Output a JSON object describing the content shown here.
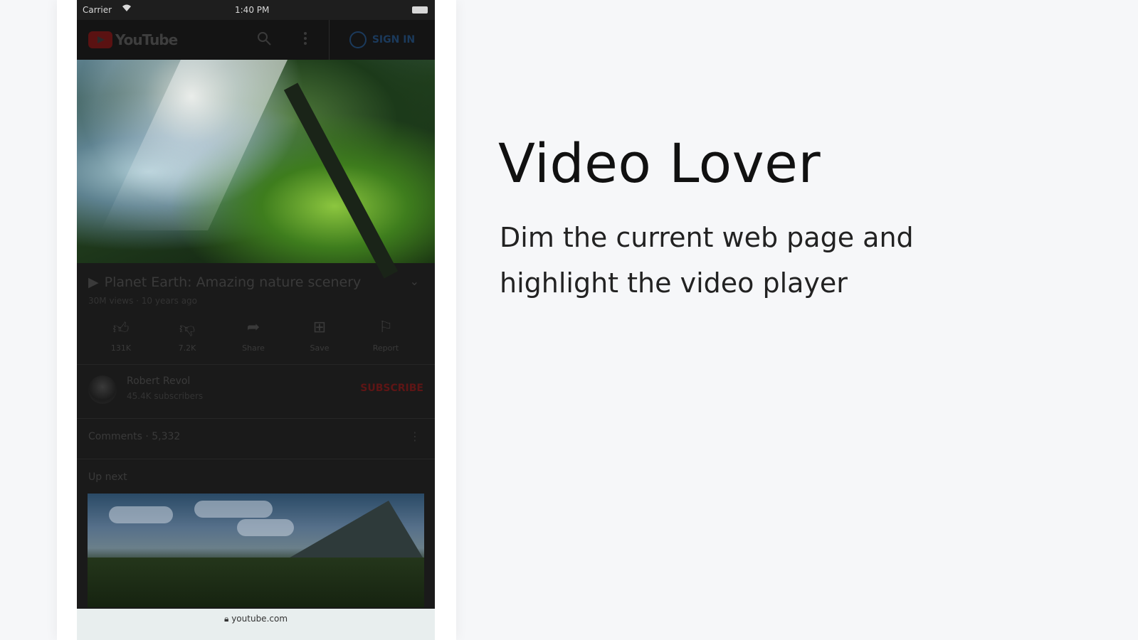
{
  "promo": {
    "title": "Video Lover",
    "description": "Dim the current web page and highlight the video player"
  },
  "status_bar": {
    "carrier": "Carrier",
    "time": "1:40 PM"
  },
  "youtube": {
    "logo_text": "YouTube",
    "sign_in_label": "SIGN IN",
    "video": {
      "title": "Planet Earth: Amazing nature scenery",
      "meta": "30M views · 10 years ago"
    },
    "actions": [
      {
        "icon": "thumbs-up-icon",
        "label": "131K"
      },
      {
        "icon": "thumbs-down-icon",
        "label": "7.2K"
      },
      {
        "icon": "share-icon",
        "label": "Share"
      },
      {
        "icon": "save-icon",
        "label": "Save"
      },
      {
        "icon": "flag-icon",
        "label": "Report"
      }
    ],
    "channel": {
      "name": "Robert Revol",
      "subscribers": "45.4K subscribers",
      "subscribe_label": "SUBSCRIBE"
    },
    "comments_label": "Comments · 5,332",
    "up_next_label": "Up next"
  },
  "browser": {
    "url": "youtube.com"
  },
  "colors": {
    "page_background": "#f6f7f9",
    "dim_overlay": "#1a1a1a",
    "subscribe_red": "#5e1515"
  }
}
